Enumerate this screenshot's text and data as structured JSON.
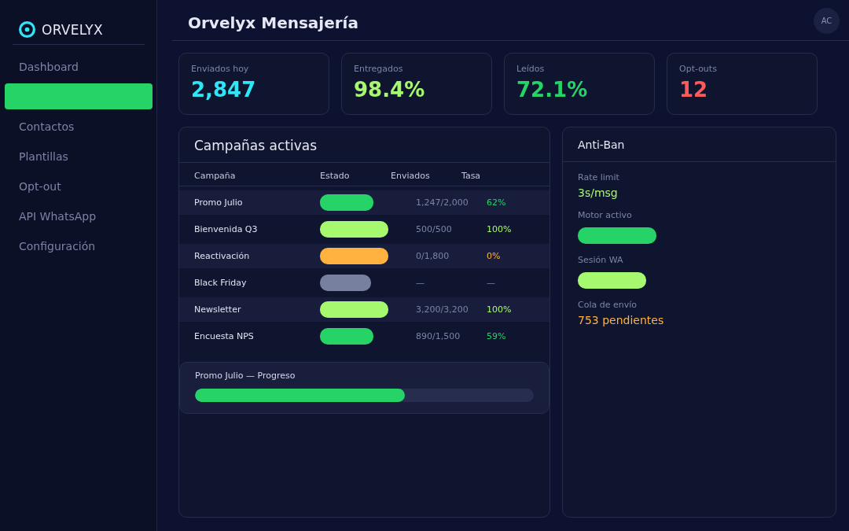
{
  "sidebar": {
    "logo": "ORVELYX",
    "items": [
      {
        "label": "Dashboard",
        "selected": false
      },
      {
        "selected": true
      },
      {
        "label": "Contactos",
        "selected": false
      },
      {
        "label": "Plantillas",
        "selected": false
      },
      {
        "label": "Opt-out",
        "selected": false
      },
      {
        "label": "API WhatsApp",
        "selected": false
      },
      {
        "label": "Configuración",
        "selected": false
      }
    ]
  },
  "header": {
    "title": "Orvelyx Mensajería",
    "avatar": "AC"
  },
  "stats": [
    {
      "label": "Enviados hoy",
      "value": "2,847",
      "color": "#2ee6f6"
    },
    {
      "label": "Entregados",
      "value": "98.4%",
      "color": "#a6f86f"
    },
    {
      "label": "Leídos",
      "value": "72.1%",
      "color": "#25d366"
    },
    {
      "label": "Opt-outs",
      "value": "12",
      "color": "#ff5a5a"
    }
  ],
  "campaigns": {
    "title": "Campañas activas",
    "columns": [
      "Campaña",
      "Estado",
      "Enviados",
      "Tasa"
    ],
    "rows": [
      {
        "name": "Promo Julio",
        "color": "#25d366",
        "sent": "1,247/2,000",
        "rate": "62%"
      },
      {
        "name": "Bienvenida Q3",
        "color": "#a6f86f",
        "sent": "500/500",
        "rate": "100%"
      },
      {
        "name": "Reactivación",
        "color": "#ffb23f",
        "sent": "0/1,800",
        "rate": "0%"
      },
      {
        "name": "Black Friday",
        "color": "#7880a0",
        "sent": "—",
        "rate": "—"
      },
      {
        "name": "Newsletter",
        "color": "#a6f86f",
        "sent": "3,200/3,200",
        "rate": "100%"
      },
      {
        "name": "Encuesta NPS",
        "color": "#25d366",
        "sent": "890/1,500",
        "rate": "59%"
      }
    ],
    "progress": {
      "label": "Promo Julio — Progreso",
      "level": 0.62
    }
  },
  "anti_ban": {
    "title": "Anti-Ban",
    "items": [
      {
        "kind": "value",
        "label": "Rate limit",
        "value": "3s/msg",
        "color": "#a6f86f"
      },
      {
        "kind": "pill",
        "label": "Motor activo",
        "color": "#25d366"
      },
      {
        "kind": "pill",
        "label": "Sesión WA",
        "color": "#a6f86f"
      },
      {
        "kind": "value",
        "label": "Cola de envío",
        "value": "753 pendientes",
        "color": "#ffb23f"
      }
    ]
  }
}
